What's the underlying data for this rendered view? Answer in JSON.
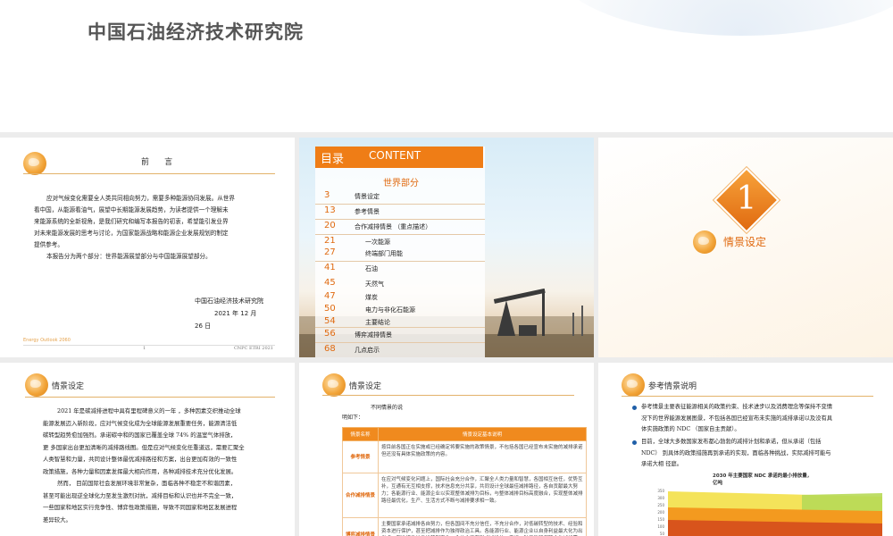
{
  "header": {
    "title": "中国石油经济技术研究院"
  },
  "slide1": {
    "title": "前      言",
    "paragraph1": "应对气候变化需要全人类共同相向努力，需要多种能源协同发展。从世界看中国，从能源看油气，展望中长期能源发展趋势，为读者提供一个理解未来能源系统的全新视角，是我们研究和编写本报告的初衷，希望能引发业界对未来能源发展的思考与讨论，为国家能源战略和能源企业发展规划的制定提供参考。",
    "paragraph1_lines": [
      "应对气候变化需要全人类共同相向努力，需要多种能源协同发展。从世界",
      "看中国，从能源看油气，展望中长期能源发展趋势，为读者提供一个理解未",
      "来能源系统的全新视角，是我们研究和编写本报告的初衷，希望能引发业界",
      "对未来能源发展的思考与讨论，为国家能源战略和能源企业发展规划的制定",
      "提供参考。"
    ],
    "paragraph2": "本报告分为两个部分：世界能源展望部分与中国能源展望部分。",
    "org": "中国石油经济技术研究院",
    "date": "2021 年 12 月",
    "day": "26 日",
    "footer_left": "Energy Outlook 2060",
    "page": "1",
    "footer_right": "CNPC ETRI 2021"
  },
  "slide2": {
    "head_cn": "目录",
    "head_en": "CONTENT",
    "section": "世界部分",
    "items": [
      {
        "num": "3",
        "label": "情景设定"
      },
      {
        "num": "13",
        "label": "参考情景"
      },
      {
        "num": "20",
        "label": "合作减排情景   （重点描述）"
      },
      {
        "num": "21",
        "label": "一次能源"
      },
      {
        "num": "27",
        "label": "终端部门用能"
      },
      {
        "num": "41",
        "label": "石油"
      },
      {
        "num": "45",
        "label": "天然气"
      },
      {
        "num": "47",
        "label": "煤炭"
      },
      {
        "num": "50",
        "label": "电力与非化石能源"
      },
      {
        "num": "54",
        "label": "主要结论"
      },
      {
        "num": "56",
        "label": "博弈减排情景"
      },
      {
        "num": "68",
        "label": "几点启示"
      }
    ]
  },
  "slide3": {
    "number": "1",
    "title": "情景设定"
  },
  "slide4": {
    "title": "情景设定",
    "lines": [
      "2021 年是碳减排进程中具有里程碑意义的一年 ，多种因素交织推动全球",
      "能源发展迈入新阶段，应对气候变化成为全球能源发展重要任务，能源清洁低",
      "碳转型趋势愈加强烈。承诺碳中和的国家已覆盖全球 74% 的温室气体排放，",
      "更 多国家出台更加清晰的减排路线图。但是应对气候变化任重道远，需要汇聚全",
      "人类智慧和力量，共同设计整体最优减排路径和方案，出台更加有效的一致性",
      "政策措施，各种力量和因素发挥最大相向作用，各种减排技术充分优化发展。",
      "然而，    目前国际社会发展环境非常复杂，面临各种不稳定不和谐因素，",
      "甚至可能出现逆全球化力至发生激烈对抗，减排目标和认识也并不完全一致，",
      "一些国家和地区实行竞争性、博弈性政策措施，导致不同国家和地区发展进程",
      "差异较大。"
    ]
  },
  "slide5": {
    "title": "情景设定",
    "subtitle": "不同情景的说",
    "subtitle2": "明如下：",
    "columns": [
      "情景名称",
      "情景设定基本说明"
    ],
    "rows": [
      {
        "name": "参考情景",
        "desc": "按目前各国正在实施或已经确定将要实施的政策情景，不包括各国已经宣布未实施的减排承诺但还没有具体实施政策的内容。"
      },
      {
        "name": "合作减排情景",
        "desc": "在应对气候变化问题上，国际社会充分合作，汇聚全人类力量和智慧，各国相互信任，优势互补，互通有无互相支撑，技术信息充分共享，共同设计全球最佳减排路径，各自贡献最大努力；各能源行业、能源企业以实现整体减排为目标，与整体减排目标高度融合，实现整体减排路径最优化，生产、生活方式不断与减排要求相一致。"
      },
      {
        "name": "博弈减排情景",
        "desc": "主要国家承诺减排各自努力，但各国间不充分信任，不充分合作，对低碳转型的技术、经验和资本进行保护，甚至把减排作为独得政治工具。各能源行业、能源企业以自身利益最大化为出发点，有选择性地推进转型变化，全社会没有形成减排统一意识，缺乏能够保障合作减排需要，生活方式"
      }
    ]
  },
  "slide6": {
    "title": "参考情景说明",
    "bullet1_lines": [
      "参考情景主要表征能源相关的政策约束、技术进步以及消费理念等保持不变情",
      "况下的世界能源发展图景，不包括各国已经宣布未实施的减排承诺以及没有具",
      "体实施政策的 NDC （国家自主贡献）。"
    ],
    "bullet2_lines": [
      "目前，全球大多数国家发布都心勃勃的减排计划和承诺，但从承诺（包括",
      "NDC） 到具体的政策措施再到承诺的实现，面临各种挑战，实际减排可能与",
      "承诺大相 径庭。"
    ],
    "chart_title": "2030 年主要国家 NDC 承诺的最小排放量，",
    "chart_unit": "亿吨",
    "chart_ticks": [
      "350",
      "300",
      "250",
      "200",
      "150",
      "100",
      "50"
    ],
    "colors": {
      "yellow": "#f4e35a",
      "orange": "#f39a1f",
      "red": "#d8541c",
      "green": "#b7d957"
    }
  },
  "colors": {
    "accent": "#ef7d16",
    "toc_num": "#e06a10"
  }
}
